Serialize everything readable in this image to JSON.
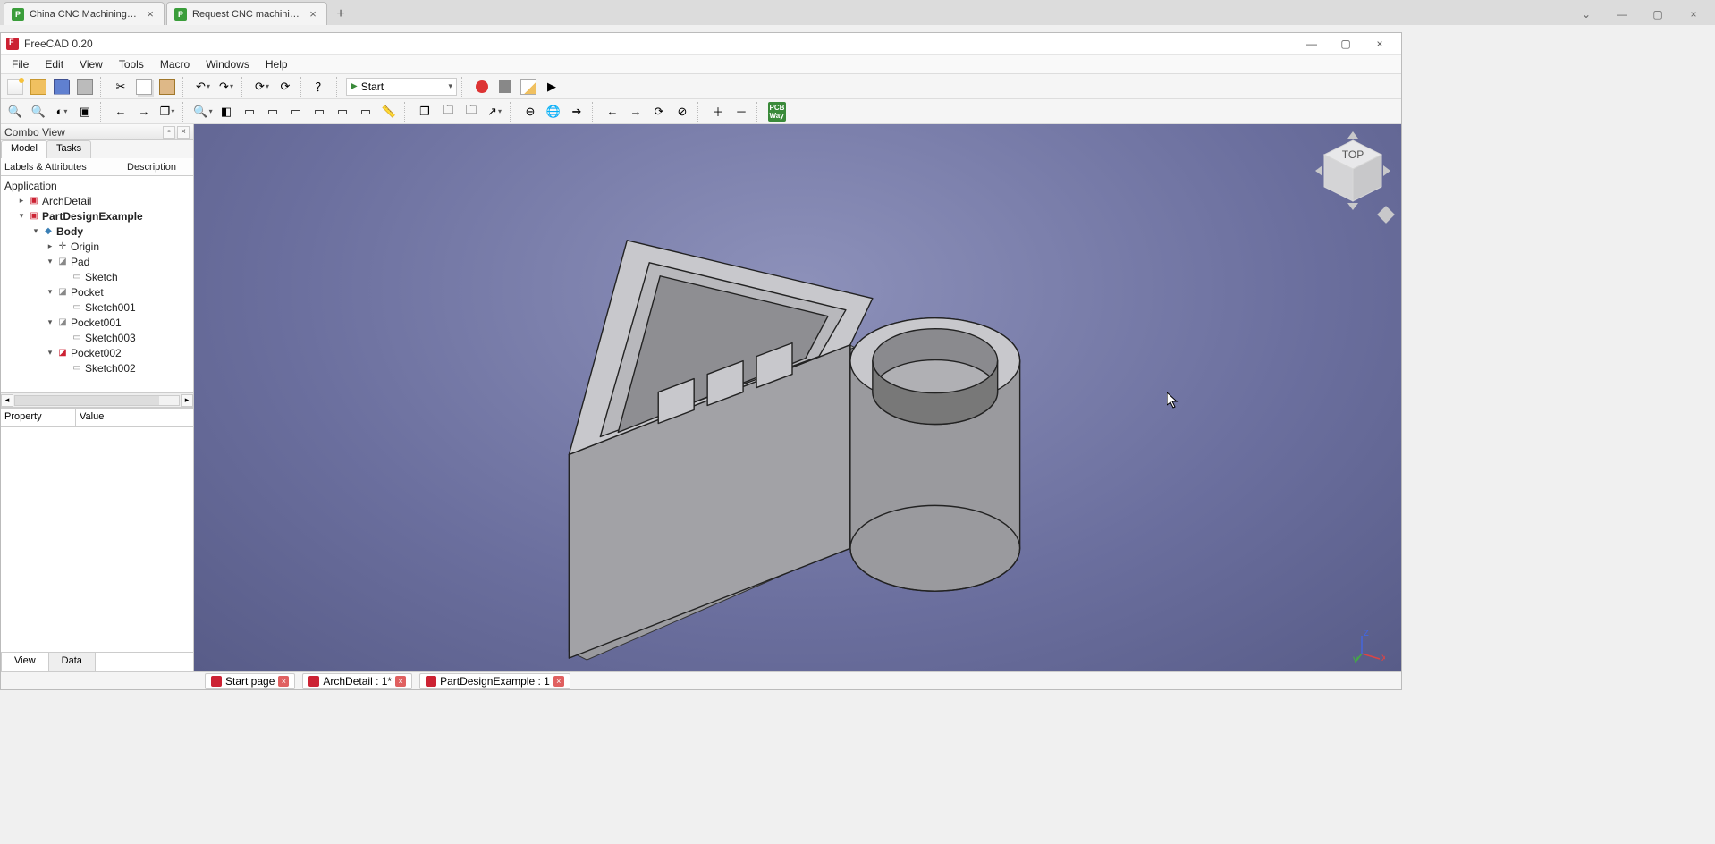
{
  "browser": {
    "tabs": [
      {
        "title": "China CNC Machining Prototy"
      },
      {
        "title": "Request CNC machining quot"
      }
    ],
    "close_glyph": "×",
    "newtab_glyph": "+",
    "ctrl_min": "—",
    "ctrl_max": "▢",
    "ctrl_close": "×",
    "ctrl_chevron": "⌄"
  },
  "freecad": {
    "title": "FreeCAD 0.20",
    "win_min": "—",
    "win_max": "▢",
    "win_close": "×",
    "menu": [
      "File",
      "Edit",
      "View",
      "Tools",
      "Macro",
      "Windows",
      "Help"
    ],
    "workbench": {
      "icon": "▶",
      "label": "Start"
    },
    "toolbar1": [
      {
        "name": "new-file",
        "glyph": "",
        "cls": "ic-new"
      },
      {
        "name": "open-file",
        "glyph": "",
        "cls": "ic-open"
      },
      {
        "name": "save-file",
        "glyph": "",
        "cls": "ic-save"
      },
      {
        "name": "print",
        "glyph": "",
        "cls": "ic-print"
      },
      {
        "sep": true
      },
      {
        "name": "cut",
        "glyph": "✂",
        "cls": "ic-cut"
      },
      {
        "name": "copy",
        "glyph": "",
        "cls": "ic-copy"
      },
      {
        "name": "paste",
        "glyph": "",
        "cls": "ic-paste"
      },
      {
        "sep": true
      },
      {
        "name": "undo",
        "glyph": "↶",
        "cls": "ic-undo",
        "dd": true
      },
      {
        "name": "redo",
        "glyph": "↷",
        "cls": "ic-redo",
        "dd": true
      },
      {
        "sep": true
      },
      {
        "name": "refresh-dep",
        "glyph": "⟳",
        "cls": "ic-refresh",
        "dd": true
      },
      {
        "name": "recompute",
        "glyph": "⟳",
        "cls": "ic-refresh"
      },
      {
        "sep": true
      },
      {
        "name": "whats-this",
        "glyph": "？",
        "cls": "ic-help"
      }
    ],
    "macro_bar": [
      {
        "name": "record-macro",
        "cls": "ic-record"
      },
      {
        "name": "stop-macro",
        "cls": "ic-stoprec"
      },
      {
        "name": "edit-macro",
        "cls": "ic-editmacro"
      },
      {
        "name": "run-macro",
        "glyph": "▶",
        "cls": "ic-play"
      }
    ],
    "toolbar2_left": [
      {
        "name": "fit-all",
        "glyph": "🔍"
      },
      {
        "name": "fit-selection",
        "glyph": "🔍"
      },
      {
        "name": "draw-style",
        "glyph": "◐",
        "dd": true
      },
      {
        "name": "bounding-box",
        "glyph": "▣"
      },
      {
        "sep": true
      },
      {
        "name": "nav-back",
        "glyph": "←"
      },
      {
        "name": "nav-fwd",
        "glyph": "→"
      },
      {
        "name": "link-nav",
        "glyph": "❐",
        "dd": true
      },
      {
        "sep": true
      },
      {
        "name": "zoom-select",
        "glyph": "🔍",
        "dd": true
      },
      {
        "name": "isometric",
        "glyph": "◧"
      },
      {
        "name": "front",
        "glyph": "▭"
      },
      {
        "name": "top",
        "glyph": "▭"
      },
      {
        "name": "right",
        "glyph": "▭"
      },
      {
        "name": "rear",
        "glyph": "▭"
      },
      {
        "name": "bottom",
        "glyph": "▭"
      },
      {
        "name": "left",
        "glyph": "▭"
      },
      {
        "name": "measure",
        "glyph": "📏",
        "cls": "ic-measure"
      }
    ],
    "toolbar2_right": [
      {
        "name": "part-link",
        "glyph": "❐"
      },
      {
        "name": "group",
        "glyph": "🗀"
      },
      {
        "name": "link-group",
        "glyph": "🗀"
      },
      {
        "name": "link-actions",
        "glyph": "↗",
        "dd": true
      },
      {
        "sep": true
      },
      {
        "name": "web-back",
        "glyph": "⊖"
      },
      {
        "name": "web-home",
        "glyph": "🌐"
      },
      {
        "name": "web-go",
        "glyph": "➔"
      },
      {
        "sep": true
      },
      {
        "name": "web-prev",
        "glyph": "←"
      },
      {
        "name": "web-next",
        "glyph": "→"
      },
      {
        "name": "web-reload",
        "glyph": "⟳"
      },
      {
        "name": "web-stop",
        "glyph": "⊘"
      },
      {
        "sep": true
      },
      {
        "name": "web-zoom-in",
        "glyph": "＋"
      },
      {
        "name": "web-zoom-out",
        "glyph": "－"
      },
      {
        "sep": true
      },
      {
        "name": "pcb",
        "glyph": "PCB",
        "cls": "pcb"
      }
    ],
    "combo": {
      "title": "Combo View",
      "undock_glyph": "▫",
      "close_glyph": "×",
      "tabs": [
        "Model",
        "Tasks"
      ],
      "active_tab": 0,
      "header_col1": "Labels & Attributes",
      "header_col2": "Description",
      "root": "Application",
      "docs": [
        {
          "label": "ArchDetail",
          "bold": false,
          "expanded": false
        },
        {
          "label": "PartDesignExample",
          "bold": true,
          "expanded": true,
          "children": [
            {
              "label": "Body",
              "bold": true,
              "expanded": true,
              "icon": "body",
              "children": [
                {
                  "label": "Origin",
                  "icon": "origin",
                  "expander": "▸"
                },
                {
                  "label": "Pad",
                  "icon": "pad",
                  "expanded": true,
                  "children": [
                    {
                      "label": "Sketch",
                      "icon": "sketch"
                    }
                  ]
                },
                {
                  "label": "Pocket",
                  "icon": "pocket",
                  "expanded": true,
                  "children": [
                    {
                      "label": "Sketch001",
                      "icon": "sketch"
                    }
                  ]
                },
                {
                  "label": "Pocket001",
                  "icon": "pocket",
                  "expanded": true,
                  "children": [
                    {
                      "label": "Sketch003",
                      "icon": "sketch"
                    }
                  ]
                },
                {
                  "label": "Pocket002",
                  "icon": "pocket-tip",
                  "expanded": true,
                  "children": [
                    {
                      "label": "Sketch002",
                      "icon": "sketch"
                    }
                  ]
                }
              ]
            }
          ]
        }
      ],
      "prop_col1": "Property",
      "prop_col2": "Value",
      "prop_tabs": [
        "View",
        "Data"
      ],
      "prop_active": 0
    },
    "navcube_label": "TOP",
    "axis_labels": {
      "x": "x",
      "y": "y",
      "z": "z"
    },
    "status_tabs": [
      {
        "label": "Start page",
        "close": true
      },
      {
        "label": "ArchDetail : 1*",
        "close": true
      },
      {
        "label": "PartDesignExample : 1",
        "close": true
      }
    ]
  }
}
